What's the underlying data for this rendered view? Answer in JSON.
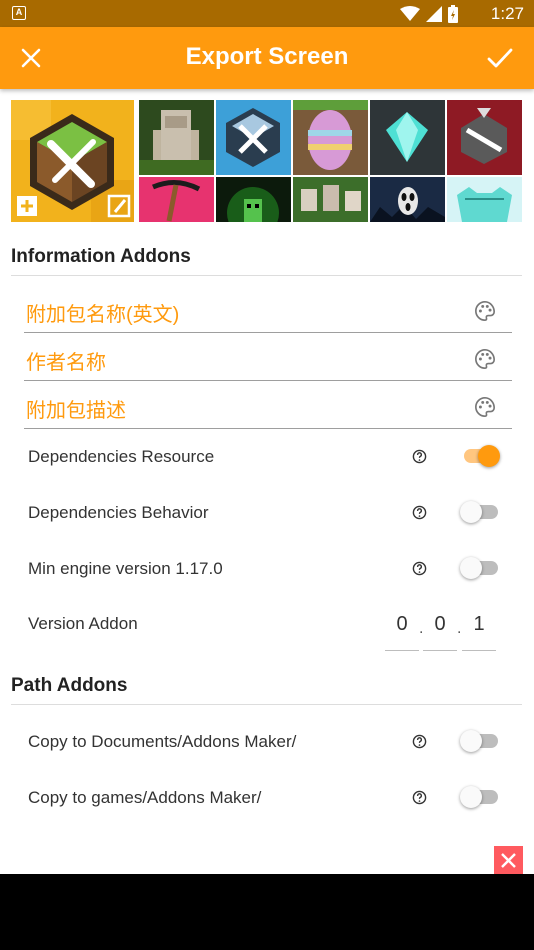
{
  "status_bar": {
    "notification_icon": "A",
    "time": "1:27",
    "icons": [
      "wifi-icon",
      "signal-icon",
      "battery-charging-icon"
    ]
  },
  "app_bar": {
    "title": "Export Screen",
    "close_icon": "close-icon",
    "confirm_icon": "check-icon"
  },
  "colors": {
    "accent": "#ff9a0e",
    "status_bar": "#a86a00",
    "logo_bg": "#f2b21c",
    "ad_close": "#ff5a5f"
  },
  "information_section": {
    "title": "Information Addons",
    "fields": [
      {
        "label": "附加包名称(英文)",
        "icon": "palette-icon"
      },
      {
        "label": "作者名称",
        "icon": "palette-icon"
      },
      {
        "label": "附加包描述",
        "icon": "palette-icon"
      }
    ],
    "toggles": [
      {
        "label": "Dependencies Resource",
        "on": true
      },
      {
        "label": "Dependencies Behavior",
        "on": false
      },
      {
        "label": "Min engine version 1.17.0",
        "on": false
      }
    ],
    "version": {
      "label": "Version Addon",
      "major": "0",
      "minor": "0",
      "patch": "1",
      "separator": "."
    }
  },
  "path_section": {
    "title": "Path Addons",
    "toggles": [
      {
        "label": "Copy to Documents/Addons Maker/",
        "on": false
      },
      {
        "label": "Copy to games/Addons Maker/",
        "on": false
      }
    ]
  },
  "icon_images": [
    "app-logo",
    "iron-golem",
    "addon-maker-logo",
    "easter-egg",
    "diamond",
    "cube-ribbon",
    "pickaxe",
    "creeper",
    "mobs",
    "ghost-face",
    "diamond-armor"
  ]
}
